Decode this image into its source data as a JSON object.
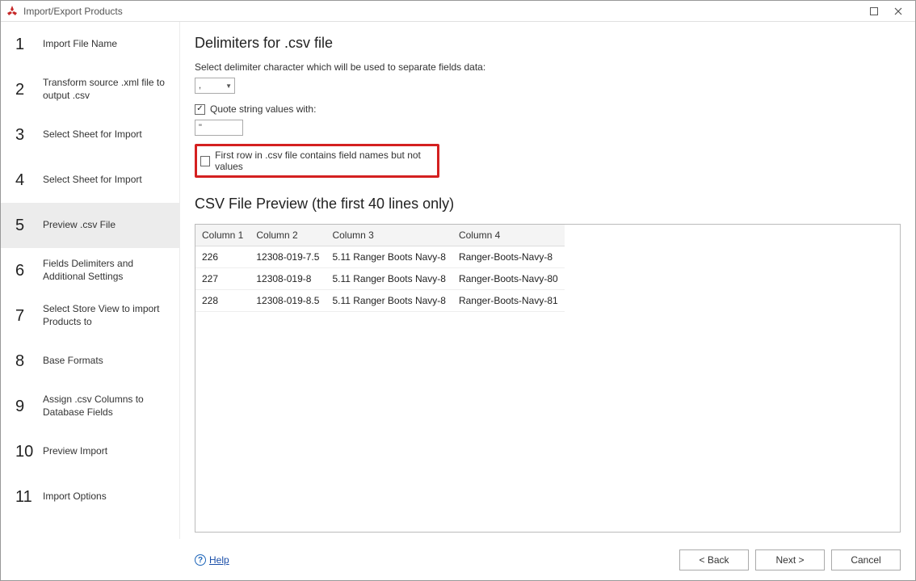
{
  "window": {
    "title": "Import/Export Products",
    "icon": "app-icon"
  },
  "sidebar": {
    "steps": [
      {
        "num": "1",
        "label": "Import File Name"
      },
      {
        "num": "2",
        "label": "Transform source .xml file to output .csv"
      },
      {
        "num": "3",
        "label": "Select Sheet for Import"
      },
      {
        "num": "4",
        "label": "Select Sheet for Import"
      },
      {
        "num": "5",
        "label": "Preview .csv File",
        "active": true
      },
      {
        "num": "6",
        "label": "Fields Delimiters and Additional Settings"
      },
      {
        "num": "7",
        "label": "Select Store View to import Products to"
      },
      {
        "num": "8",
        "label": "Base Formats"
      },
      {
        "num": "9",
        "label": "Assign .csv Columns to Database Fields"
      },
      {
        "num": "10",
        "label": "Preview Import"
      },
      {
        "num": "11",
        "label": "Import Options"
      }
    ]
  },
  "main": {
    "heading1": "Delimiters for .csv file",
    "sub1": "Select delimiter character which will be used to separate fields data:",
    "delimiter_value": ",",
    "quote_label": "Quote string values with:",
    "quote_checked": true,
    "quote_value": "\"",
    "firstrow_label": "First row in .csv file contains field names but not values",
    "firstrow_checked": false,
    "heading2": "CSV File Preview (the first 40 lines only)",
    "table": {
      "headers": [
        "Column 1",
        "Column 2",
        "Column 3",
        "Column 4"
      ],
      "rows": [
        [
          "226",
          "12308-019-7.5",
          "5.11 Ranger Boots Navy-8",
          "Ranger-Boots-Navy-8"
        ],
        [
          "227",
          "12308-019-8",
          "5.11 Ranger Boots Navy-8",
          "Ranger-Boots-Navy-80"
        ],
        [
          "228",
          "12308-019-8.5",
          "5.11 Ranger Boots Navy-8",
          "Ranger-Boots-Navy-81"
        ]
      ]
    }
  },
  "footer": {
    "help": "Help",
    "back": "< Back",
    "next": "Next >",
    "cancel": "Cancel"
  }
}
